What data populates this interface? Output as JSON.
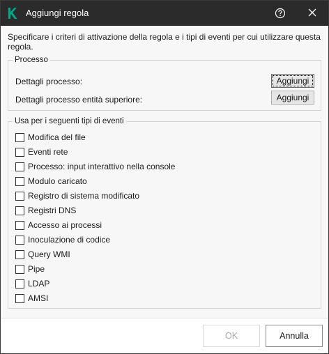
{
  "window": {
    "title": "Aggiungi regola",
    "accent_color": "#00a88e"
  },
  "description": "Specificare i criteri di attivazione della regola e i tipi di eventi per cui utilizzare questa regola.",
  "process_group": {
    "legend": "Processo",
    "rows": [
      {
        "label": "Dettagli processo:",
        "button": "Aggiungi"
      },
      {
        "label": "Dettagli processo entità superiore:",
        "button": "Aggiungi"
      }
    ]
  },
  "events_group": {
    "legend": "Usa per i seguenti tipi di eventi",
    "items": [
      {
        "label": "Modifica del file",
        "checked": false
      },
      {
        "label": "Eventi rete",
        "checked": false
      },
      {
        "label": "Processo: input interattivo nella console",
        "checked": false
      },
      {
        "label": "Modulo caricato",
        "checked": false
      },
      {
        "label": "Registro di sistema modificato",
        "checked": false
      },
      {
        "label": "Registri DNS",
        "checked": false
      },
      {
        "label": "Accesso ai processi",
        "checked": false
      },
      {
        "label": "Inoculazione di codice",
        "checked": false
      },
      {
        "label": "Query WMI",
        "checked": false
      },
      {
        "label": "Pipe",
        "checked": false
      },
      {
        "label": "LDAP",
        "checked": false
      },
      {
        "label": "AMSI",
        "checked": false
      }
    ]
  },
  "footer": {
    "ok_label": "OK",
    "cancel_label": "Annulla"
  }
}
